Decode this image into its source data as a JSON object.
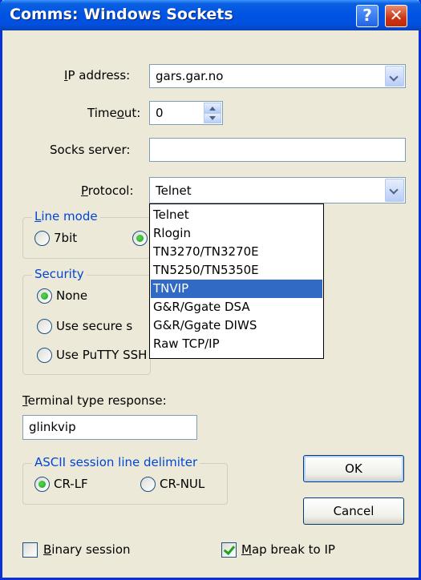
{
  "window": {
    "title": "Comms: Windows Sockets",
    "help_button": "?",
    "close_button": "✕"
  },
  "ip_address": {
    "label_pre": "",
    "label_acc": "I",
    "label_post": "P address:",
    "value": "gars.gar.no"
  },
  "timeout": {
    "label_pre": "Time",
    "label_acc": "o",
    "label_post": "ut:",
    "value": "0"
  },
  "socks_server": {
    "label": "Socks server:",
    "value": ""
  },
  "protocol": {
    "label_pre": "",
    "label_acc": "P",
    "label_post": "rotocol:",
    "value": "Telnet",
    "options": [
      "Telnet",
      "Rlogin",
      "TN3270/TN3270E",
      "TN5250/TN5350E",
      "TNVIP",
      "G&R/Ggate DSA",
      "G&R/Ggate DIWS",
      "Raw TCP/IP"
    ],
    "highlighted": "TNVIP"
  },
  "line_mode": {
    "label_acc": "L",
    "label_post": "ine mode",
    "opt_7bit": "7bit"
  },
  "security": {
    "label": "Security",
    "none": "None",
    "secure_partial": "Use secure s",
    "putty_partial": "Use PuTTY SSH"
  },
  "terminal_type": {
    "label_acc": "T",
    "label_post": "erminal type response:",
    "value": "glinkvip"
  },
  "ascii_delim": {
    "label": "ASCII session line delimiter",
    "crlf": "CR-LF",
    "crnul": "CR-NUL"
  },
  "buttons": {
    "ok": "OK",
    "cancel": "Cancel"
  },
  "binary_session": {
    "label_acc": "B",
    "label_post": "inary session",
    "checked": false
  },
  "map_break": {
    "label_acc": "M",
    "label_post": "ap break to IP",
    "checked": true
  },
  "colors": {
    "title_bar": "#0054e3",
    "selection": "#316ac5",
    "group_label": "#0046d5"
  }
}
